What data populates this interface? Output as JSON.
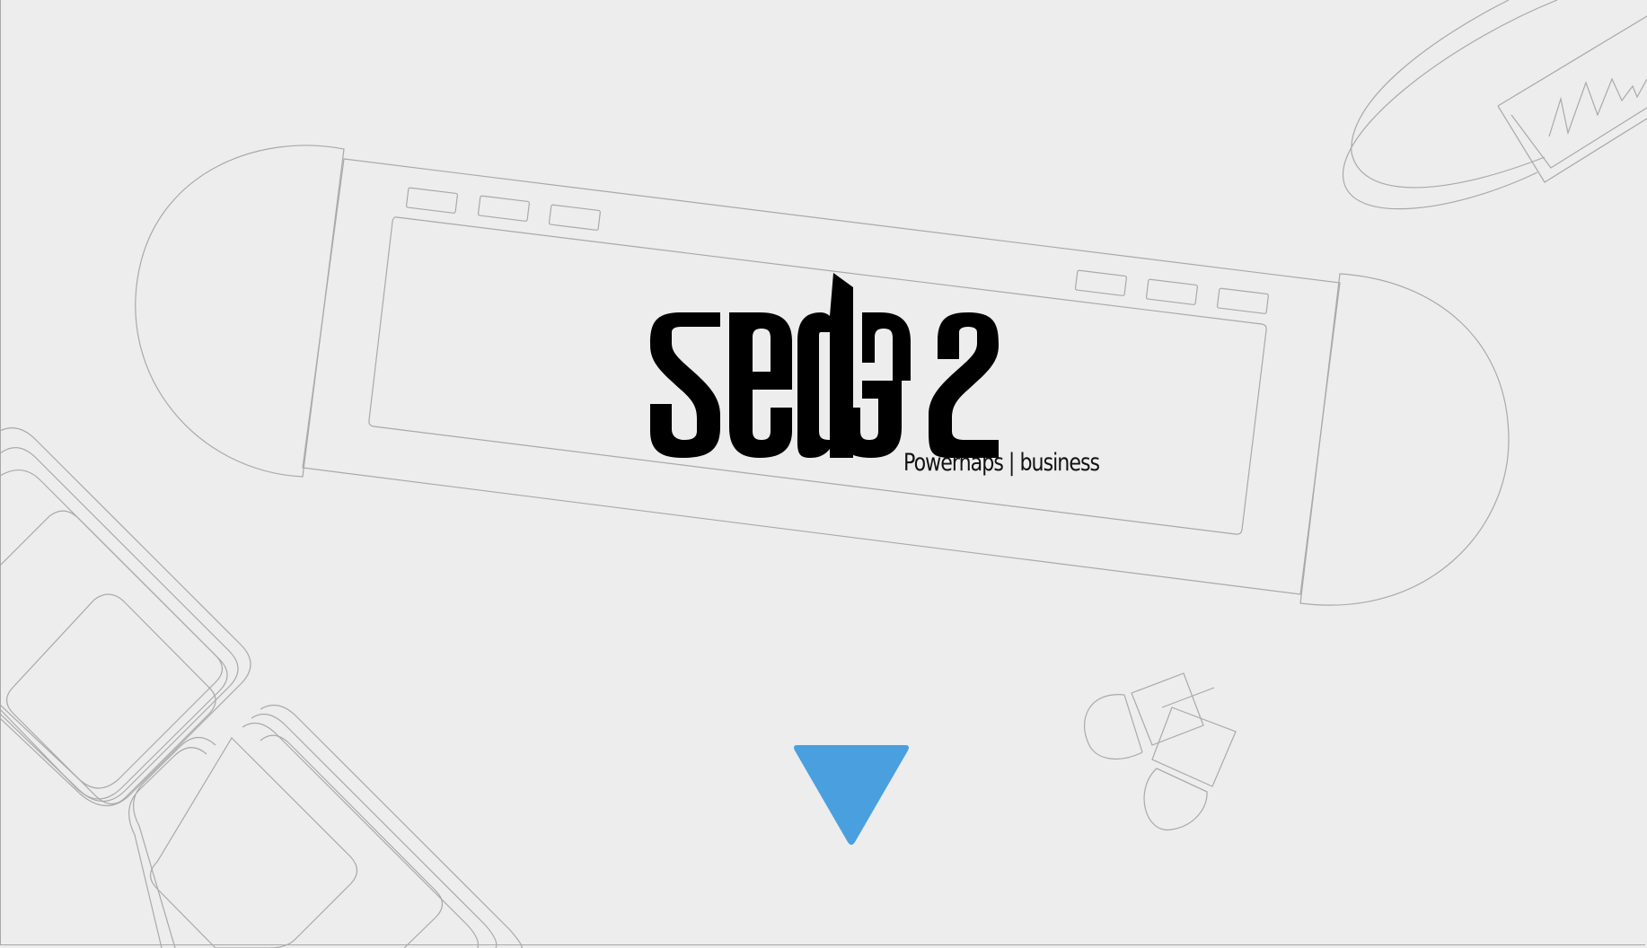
{
  "brand": {
    "tagline": "Powernaps | business",
    "logo_icon": "sedes-logo"
  },
  "scroll_indicator": {
    "icon": "triangle-down-icon",
    "color": "#4a9fdf"
  },
  "colors": {
    "background": "#ededed",
    "line_art": "#a9a9a9",
    "logo": "#000000",
    "accent": "#4a9fdf"
  }
}
